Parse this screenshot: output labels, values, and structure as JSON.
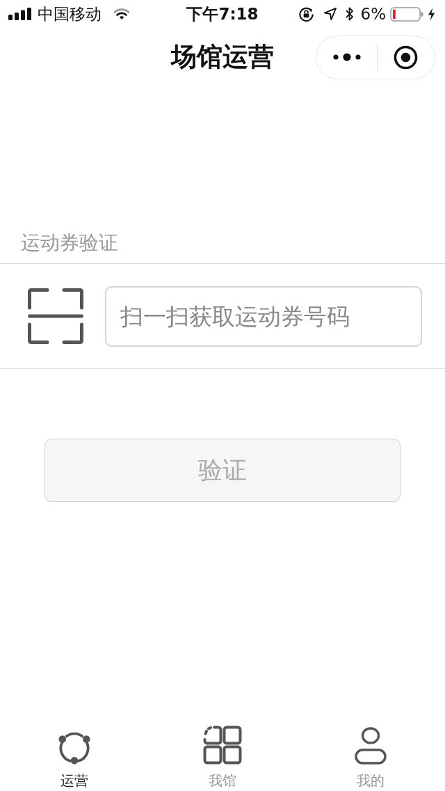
{
  "status_bar": {
    "carrier": "中国移动",
    "time": "下午7:18",
    "battery_text": "6%"
  },
  "nav_bar": {
    "title": "场馆运营"
  },
  "section": {
    "label": "运动券验证"
  },
  "voucher_input": {
    "placeholder": "扫一扫获取运动券号码"
  },
  "verify_button": {
    "label": "验证",
    "disabled": true
  },
  "tabs": [
    {
      "kind": "network",
      "label": "运营",
      "selected": true
    },
    {
      "kind": "grid",
      "label": "我馆",
      "selected": false
    },
    {
      "kind": "person",
      "label": "我的",
      "selected": false
    }
  ]
}
